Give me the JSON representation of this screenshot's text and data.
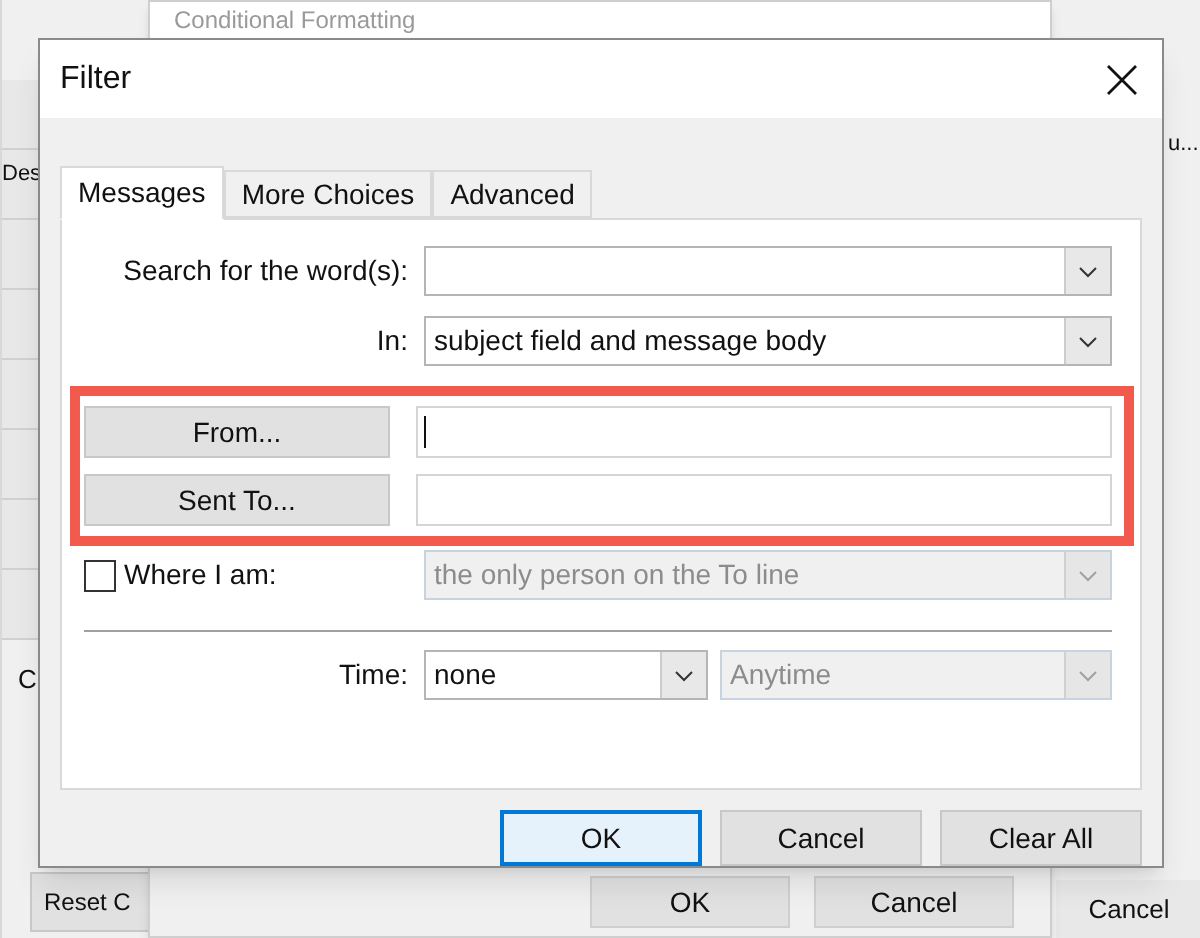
{
  "back_window": {
    "left_labels": [
      "Des",
      "C"
    ],
    "right_label": "u...",
    "reset_button": "Reset C",
    "cancel_button": "Cancel"
  },
  "conditional_dialog": {
    "title": "Conditional Formatting",
    "buttons": [
      "OK",
      "Cancel"
    ]
  },
  "filter_dialog": {
    "title": "Filter",
    "tabs": [
      {
        "label": "Messages",
        "selected": true
      },
      {
        "label": "More Choices",
        "selected": false
      },
      {
        "label": "Advanced",
        "selected": false
      }
    ],
    "search": {
      "label": "Search for the word(s):"
    },
    "in": {
      "label": "In:",
      "value": "subject field and message body"
    },
    "from": {
      "button": "From..."
    },
    "sent_to": {
      "button": "Sent To..."
    },
    "where_i_am": {
      "label": "Where I am:",
      "checked": false,
      "value": "the only person on the To line",
      "disabled": true
    },
    "time": {
      "label": "Time:",
      "value": "none",
      "range": "Anytime",
      "range_disabled": true
    },
    "buttons": [
      {
        "label": "OK",
        "focused": true
      },
      {
        "label": "Cancel",
        "focused": false
      },
      {
        "label": "Clear All",
        "focused": false
      }
    ]
  }
}
